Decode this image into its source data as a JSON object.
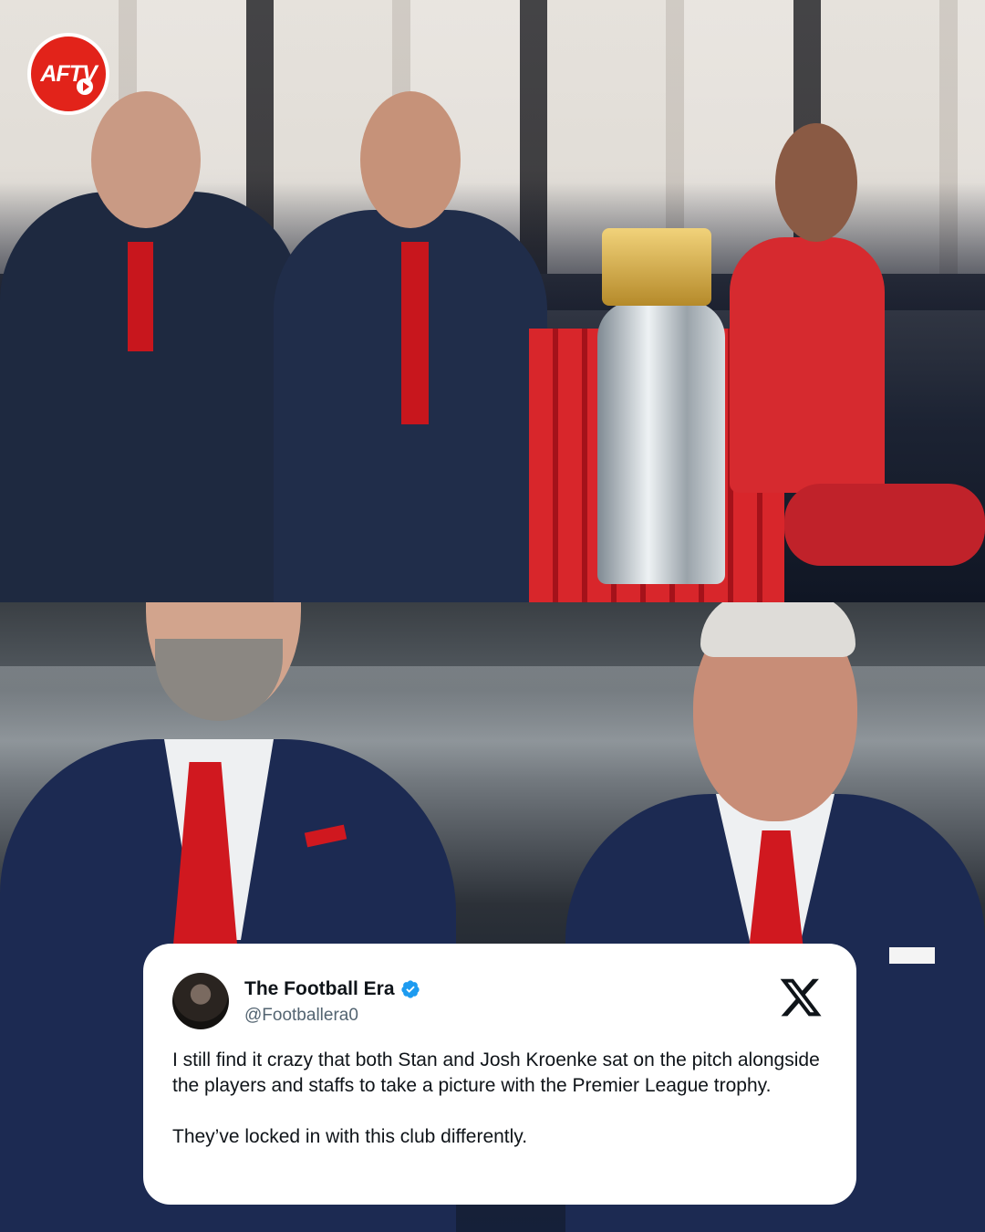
{
  "logo": {
    "text": "AFTV",
    "color": "#e2231a"
  },
  "tweet": {
    "display_name": "The Football Era",
    "handle": "@Footballera0",
    "verified_icon": "verified-badge-icon",
    "platform_icon": "x-logo-icon",
    "paragraphs": [
      "I still find it crazy that both Stan and Josh Kroenke sat on the pitch alongside the players and staffs to take a picture with the Premier League trophy.",
      "They’ve locked in with this club differently."
    ]
  },
  "colors": {
    "arsenal_red": "#e2231a",
    "suit_navy": "#1d2a4f",
    "card_bg": "#ffffff",
    "verified_blue": "#1d9bf0"
  }
}
